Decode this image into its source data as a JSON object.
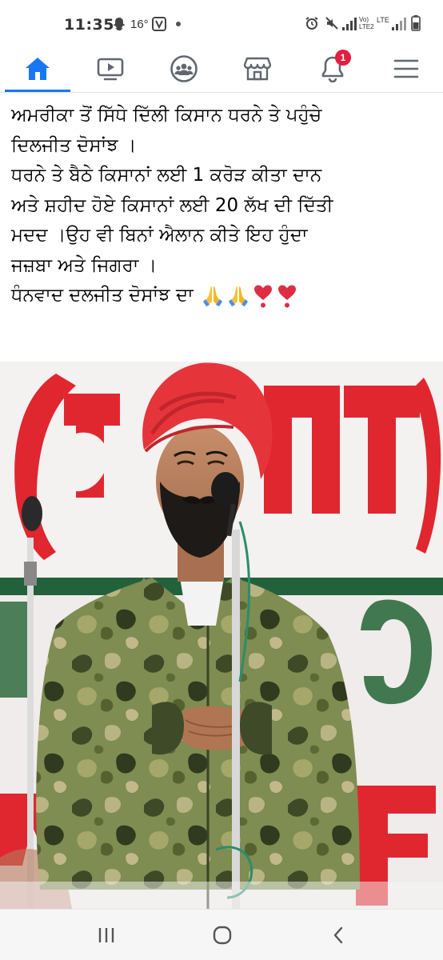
{
  "status_bar": {
    "time": "11:35",
    "temperature": "16°",
    "network": "LTE",
    "network_sub": "LTE2"
  },
  "nav": {
    "items": [
      {
        "name": "home",
        "icon": "home-icon",
        "active": true
      },
      {
        "name": "watch",
        "icon": "video-play-icon"
      },
      {
        "name": "groups",
        "icon": "groups-icon"
      },
      {
        "name": "marketplace",
        "icon": "store-icon"
      },
      {
        "name": "notifications",
        "icon": "bell-icon",
        "badge": "1"
      },
      {
        "name": "menu",
        "icon": "hamburger-menu-icon"
      }
    ],
    "accent_color": "#1877f2",
    "badge_color": "#e41e3f"
  },
  "post": {
    "lines": [
      "ਅਮਰੀਕਾ ਤੋਂ ਸਿੱਧੇ ਦਿੱਲੀ ਕਿਸਾਨ ਧਰਨੇ ਤੇ ਪਹੁੰਚੇ",
      "ਦਿਲਜੀਤ ਦੋਸਾਂਝ ।",
      "ਧਰਨੇ ਤੇ ਬੈਠੇ ਕਿਸਾਨਾਂ ਲਈ 1 ਕਰੋੜ ਕੀਤਾ ਦਾਨ",
      "ਅਤੇ ਸ਼ਹੀਦ ਹੋਏ ਕਿਸਾਨਾਂ ਲਈ 20 ਲੱਖ ਦੀ ਦਿੱਤੀ",
      "ਮਦਦ ।ਉਹ ਵੀ ਬਿਨਾਂ ਐਲਾਨ ਕੀਤੇ ਇਹ ਹੁੰਦਾ",
      "ਜਜ਼ਬਾ ਅਤੇ ਜਿਗਰਾ ।",
      "ਧੰਨਵਾਦ ਦਲਜੀਤ ਦੋਸਾਂਝ ਦਾ"
    ],
    "emojis": [
      "folded-hands-emoji",
      "folded-hands-emoji",
      "heart-exclamation-emoji",
      "heart-exclamation-emoji"
    ]
  },
  "photo": {
    "colors": {
      "banner": "#f2efee",
      "banner_text_red": "#e0272f",
      "turban": "#e5353b",
      "jacket_base": "#7c8a4e"
    }
  },
  "android_nav": {
    "buttons": [
      "recent-apps-icon",
      "home-circle-icon",
      "back-icon"
    ]
  }
}
